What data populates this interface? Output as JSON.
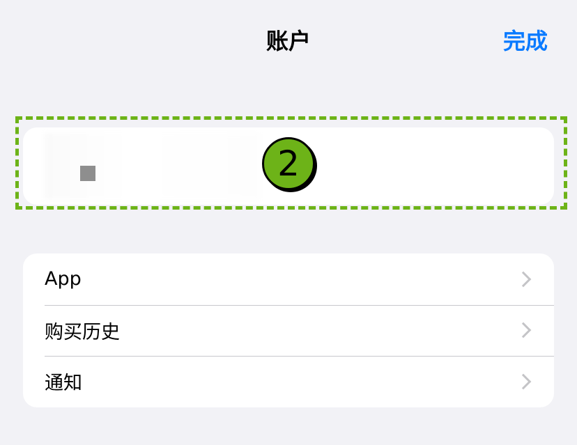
{
  "header": {
    "title": "账户",
    "done_label": "完成"
  },
  "annotation": {
    "step_number": "2",
    "highlight_color": "#6db318"
  },
  "menu": {
    "items": [
      {
        "label": "App"
      },
      {
        "label": "购买历史"
      },
      {
        "label": "通知"
      }
    ]
  },
  "colors": {
    "accent": "#0a7aff",
    "background": "#f2f2f6"
  }
}
